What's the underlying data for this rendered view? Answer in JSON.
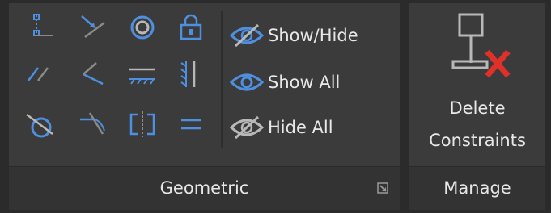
{
  "geometric": {
    "title": "Geometric",
    "tools_row1": [
      "coincident-icon",
      "collinear-icon",
      "concentric-icon",
      "fix-icon"
    ],
    "tools_row2": [
      "parallel-icon",
      "perpendicular-icon",
      "horizontal-icon",
      "vertical-icon"
    ],
    "tools_row3": [
      "tangent-icon",
      "smooth-icon",
      "symmetric-icon",
      "equal-icon"
    ],
    "visibility": {
      "show_hide": "Show/Hide",
      "show_all": "Show All",
      "hide_all": "Hide All"
    },
    "launcher_icon": "dialog-launcher-icon"
  },
  "manage": {
    "title": "Manage",
    "delete_line1": "Delete",
    "delete_line2": "Constraints",
    "delete_icon": "delete-constraints-icon"
  },
  "colors": {
    "background": "#2b2b2b",
    "panel": "#3b3b3b",
    "title_bar": "#333333",
    "icon_blue": "#4f8fe0",
    "icon_gray": "#8a8a8a",
    "delete_red": "#e0302a",
    "text": "#e8e8e8"
  }
}
